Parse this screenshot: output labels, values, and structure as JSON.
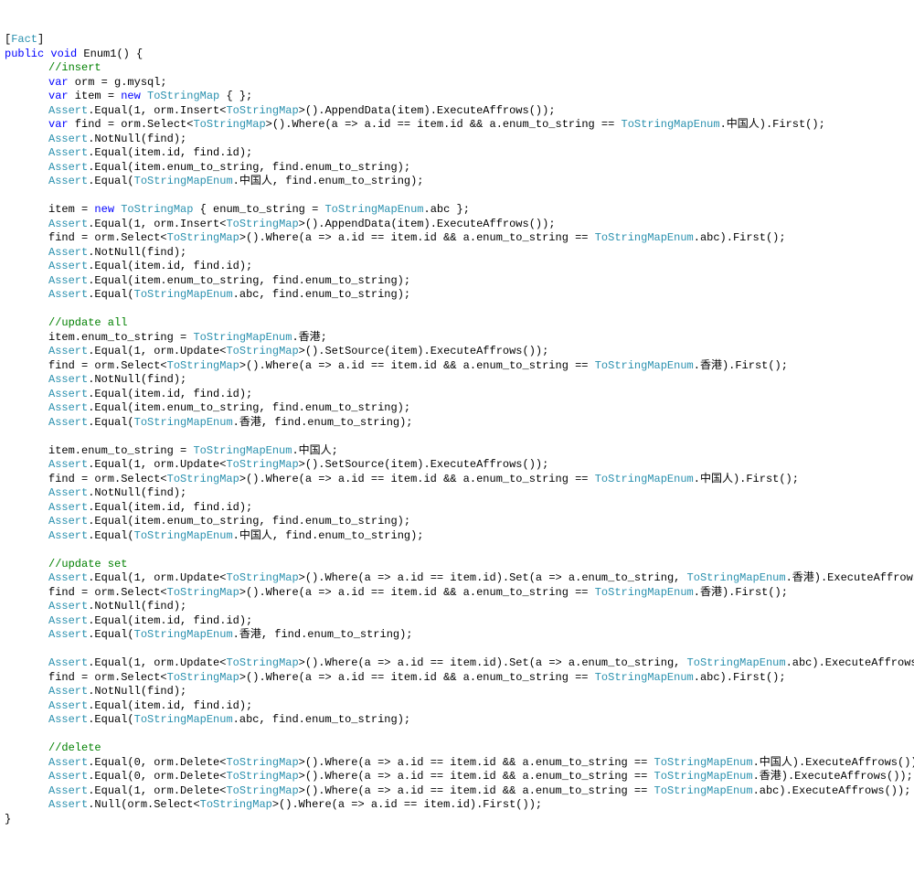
{
  "attr": "[Fact]",
  "sig": {
    "public": "public",
    "void": "void",
    "name": " Enum1() {"
  },
  "c1": "//insert",
  "l1": {
    "var": "var",
    "rest": " orm = g.mysql;"
  },
  "l2": {
    "var": "var",
    "rest1": " item = ",
    "new": "new",
    "type": " ToStringMap",
    "rest2": " { };"
  },
  "l3": {
    "a": "Assert",
    "rest1": ".Equal(1, orm.Insert<",
    "type": "ToStringMap",
    "rest2": ">().AppendData(item).ExecuteAffrows());"
  },
  "l4": {
    "var": "var",
    "rest1": " find = orm.Select<",
    "type": "ToStringMap",
    "rest2": ">().Where(a => a.id == item.id && a.enum_to_string == ",
    "enum": "ToStringMapEnum",
    "rest3": ".中国人).First();"
  },
  "l5": {
    "a": "Assert",
    "rest": ".NotNull(find);"
  },
  "l6": {
    "a": "Assert",
    "rest": ".Equal(item.id, find.id);"
  },
  "l7": {
    "a": "Assert",
    "rest": ".Equal(item.enum_to_string, find.enum_to_string);"
  },
  "l8": {
    "a": "Assert",
    "rest1": ".Equal(",
    "enum": "ToStringMapEnum",
    "rest2": ".中国人, find.enum_to_string);"
  },
  "l9": {
    "rest1": "item = ",
    "new": "new",
    "type": " ToStringMap",
    "rest2": " { enum_to_string = ",
    "enum": "ToStringMapEnum",
    "rest3": ".abc };"
  },
  "l10": {
    "a": "Assert",
    "rest1": ".Equal(1, orm.Insert<",
    "type": "ToStringMap",
    "rest2": ">().AppendData(item).ExecuteAffrows());"
  },
  "l11": {
    "rest1": "find = orm.Select<",
    "type": "ToStringMap",
    "rest2": ">().Where(a => a.id == item.id && a.enum_to_string == ",
    "enum": "ToStringMapEnum",
    "rest3": ".abc).First();"
  },
  "l12": {
    "a": "Assert",
    "rest": ".NotNull(find);"
  },
  "l13": {
    "a": "Assert",
    "rest": ".Equal(item.id, find.id);"
  },
  "l14": {
    "a": "Assert",
    "rest": ".Equal(item.enum_to_string, find.enum_to_string);"
  },
  "l15": {
    "a": "Assert",
    "rest1": ".Equal(",
    "enum": "ToStringMapEnum",
    "rest2": ".abc, find.enum_to_string);"
  },
  "c2": "//update all",
  "l16": {
    "rest1": "item.enum_to_string = ",
    "enum": "ToStringMapEnum",
    "rest2": ".香港;"
  },
  "l17": {
    "a": "Assert",
    "rest1": ".Equal(1, orm.Update<",
    "type": "ToStringMap",
    "rest2": ">().SetSource(item).ExecuteAffrows());"
  },
  "l18": {
    "rest1": "find = orm.Select<",
    "type": "ToStringMap",
    "rest2": ">().Where(a => a.id == item.id && a.enum_to_string == ",
    "enum": "ToStringMapEnum",
    "rest3": ".香港).First();"
  },
  "l19": {
    "a": "Assert",
    "rest": ".NotNull(find);"
  },
  "l20": {
    "a": "Assert",
    "rest": ".Equal(item.id, find.id);"
  },
  "l21": {
    "a": "Assert",
    "rest": ".Equal(item.enum_to_string, find.enum_to_string);"
  },
  "l22": {
    "a": "Assert",
    "rest1": ".Equal(",
    "enum": "ToStringMapEnum",
    "rest2": ".香港, find.enum_to_string);"
  },
  "l23": {
    "rest1": "item.enum_to_string = ",
    "enum": "ToStringMapEnum",
    "rest2": ".中国人;"
  },
  "l24": {
    "a": "Assert",
    "rest1": ".Equal(1, orm.Update<",
    "type": "ToStringMap",
    "rest2": ">().SetSource(item).ExecuteAffrows());"
  },
  "l25": {
    "rest1": "find = orm.Select<",
    "type": "ToStringMap",
    "rest2": ">().Where(a => a.id == item.id && a.enum_to_string == ",
    "enum": "ToStringMapEnum",
    "rest3": ".中国人).First();"
  },
  "l26": {
    "a": "Assert",
    "rest": ".NotNull(find);"
  },
  "l27": {
    "a": "Assert",
    "rest": ".Equal(item.id, find.id);"
  },
  "l28": {
    "a": "Assert",
    "rest": ".Equal(item.enum_to_string, find.enum_to_string);"
  },
  "l29": {
    "a": "Assert",
    "rest1": ".Equal(",
    "enum": "ToStringMapEnum",
    "rest2": ".中国人, find.enum_to_string);"
  },
  "c3": "//update set",
  "l30": {
    "a": "Assert",
    "rest1": ".Equal(1, orm.Update<",
    "type": "ToStringMap",
    "rest2": ">().Where(a => a.id == item.id).Set(a => a.enum_to_string, ",
    "enum": "ToStringMapEnum",
    "rest3": ".香港).ExecuteAffrows());"
  },
  "l31": {
    "rest1": "find = orm.Select<",
    "type": "ToStringMap",
    "rest2": ">().Where(a => a.id == item.id && a.enum_to_string == ",
    "enum": "ToStringMapEnum",
    "rest3": ".香港).First();"
  },
  "l32": {
    "a": "Assert",
    "rest": ".NotNull(find);"
  },
  "l33": {
    "a": "Assert",
    "rest": ".Equal(item.id, find.id);"
  },
  "l34": {
    "a": "Assert",
    "rest1": ".Equal(",
    "enum": "ToStringMapEnum",
    "rest2": ".香港, find.enum_to_string);"
  },
  "l35": {
    "a": "Assert",
    "rest1": ".Equal(1, orm.Update<",
    "type": "ToStringMap",
    "rest2": ">().Where(a => a.id == item.id).Set(a => a.enum_to_string, ",
    "enum": "ToStringMapEnum",
    "rest3": ".abc).ExecuteAffrows());"
  },
  "l36": {
    "rest1": "find = orm.Select<",
    "type": "ToStringMap",
    "rest2": ">().Where(a => a.id == item.id && a.enum_to_string == ",
    "enum": "ToStringMapEnum",
    "rest3": ".abc).First();"
  },
  "l37": {
    "a": "Assert",
    "rest": ".NotNull(find);"
  },
  "l38": {
    "a": "Assert",
    "rest": ".Equal(item.id, find.id);"
  },
  "l39": {
    "a": "Assert",
    "rest1": ".Equal(",
    "enum": "ToStringMapEnum",
    "rest2": ".abc, find.enum_to_string);"
  },
  "c4": "//delete",
  "l40": {
    "a": "Assert",
    "rest1": ".Equal(0, orm.Delete<",
    "type": "ToStringMap",
    "rest2": ">().Where(a => a.id == item.id && a.enum_to_string == ",
    "enum": "ToStringMapEnum",
    "rest3": ".中国人).ExecuteAffrows());"
  },
  "l41": {
    "a": "Assert",
    "rest1": ".Equal(0, orm.Delete<",
    "type": "ToStringMap",
    "rest2": ">().Where(a => a.id == item.id && a.enum_to_string == ",
    "enum": "ToStringMapEnum",
    "rest3": ".香港).ExecuteAffrows());"
  },
  "l42": {
    "a": "Assert",
    "rest1": ".Equal(1, orm.Delete<",
    "type": "ToStringMap",
    "rest2": ">().Where(a => a.id == item.id && a.enum_to_string == ",
    "enum": "ToStringMapEnum",
    "rest3": ".abc).ExecuteAffrows());"
  },
  "l43": {
    "a": "Assert",
    "rest1": ".Null(orm.Select<",
    "type": "ToStringMap",
    "rest2": ">().Where(a => a.id == item.id).First());"
  },
  "close": "}"
}
